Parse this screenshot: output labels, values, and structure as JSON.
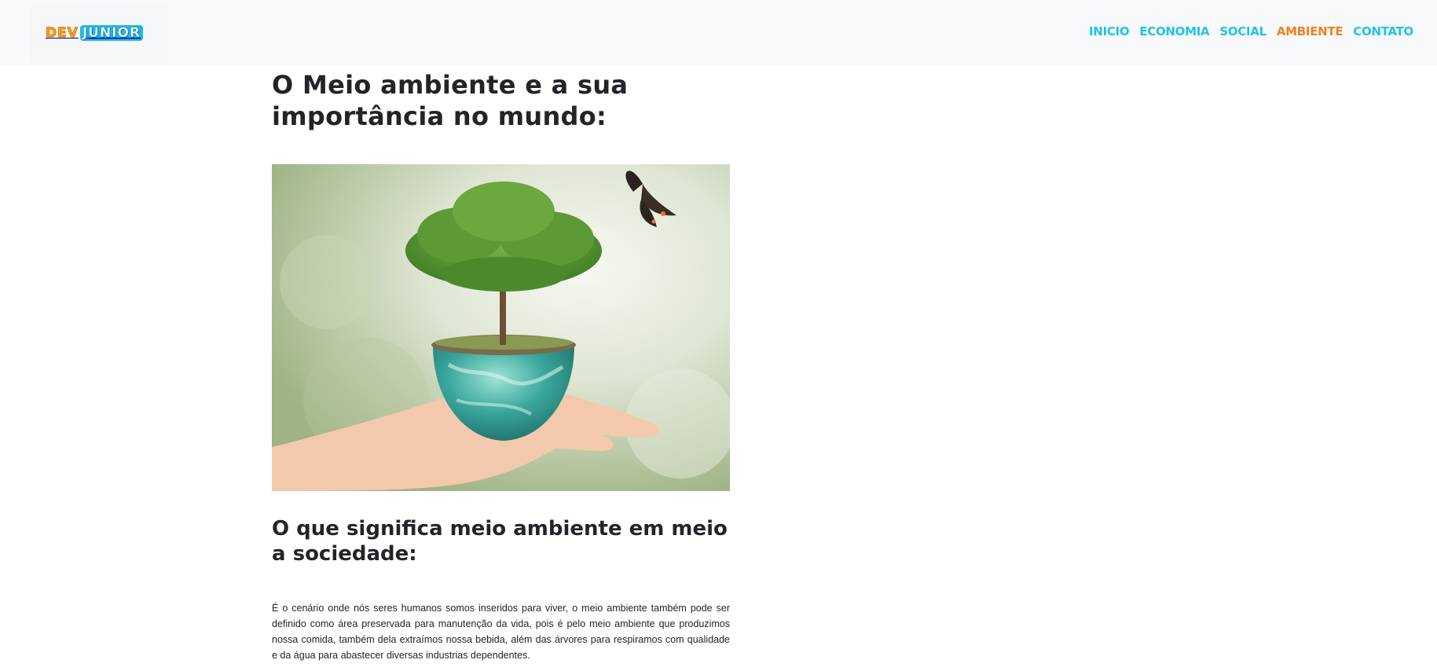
{
  "header": {
    "logo": {
      "part1": "DEV",
      "part2": "JUNIOR"
    },
    "nav": [
      {
        "label": "INICIO",
        "active": false
      },
      {
        "label": "ECONOMIA",
        "active": false
      },
      {
        "label": "SOCIAL",
        "active": false
      },
      {
        "label": "AMBIENTE",
        "active": true
      },
      {
        "label": "CONTATO",
        "active": false
      }
    ]
  },
  "main": {
    "title": "O Meio ambiente e a sua importância no mundo:",
    "hero_image": {
      "icon": "globe-tree-in-hand-image"
    },
    "section_title": "O que significa meio ambiente em meio a sociedade:",
    "paragraph": "É o cenário onde nós seres humanos somos inseridos para viver, o meio ambiente também pode ser definido como área preservada para manutenção da vida, pois é pelo meio ambiente que produzimos nossa comida, também dela extraímos nossa bebida, além das árvores para respiramos com qualidade e da água para abastecer diversas industrias dependentes."
  },
  "colors": {
    "nav_link": "#22c3e6",
    "nav_active": "#f47f20",
    "navbar_bg": "#f8f9fa",
    "text": "#212529"
  }
}
